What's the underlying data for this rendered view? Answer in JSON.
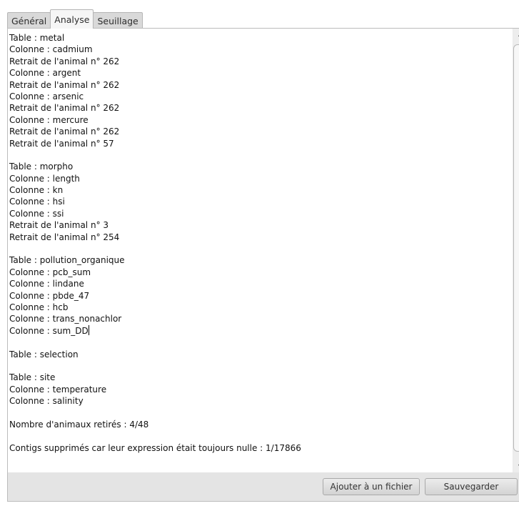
{
  "tabs": [
    {
      "label": "Général",
      "active": false
    },
    {
      "label": "Analyse",
      "active": true
    },
    {
      "label": "Seuillage",
      "active": false
    }
  ],
  "log": {
    "lines": [
      "Table : metal",
      "Colonne : cadmium",
      "Retrait de l'animal n° 262",
      "Colonne : argent",
      "Retrait de l'animal n° 262",
      "Colonne : arsenic",
      "Retrait de l'animal n° 262",
      "Colonne : mercure",
      "Retrait de l'animal n° 262",
      "Retrait de l'animal n° 57",
      "",
      "Table : morpho",
      "Colonne : length",
      "Colonne : kn",
      "Colonne : hsi",
      "Colonne : ssi",
      "Retrait de l'animal n° 3",
      "Retrait de l'animal n° 254",
      "",
      "Table : pollution_organique",
      "Colonne : pcb_sum",
      "Colonne : lindane",
      "Colonne : pbde_47",
      "Colonne : hcb",
      "Colonne : trans_nonachlor",
      "Colonne : sum_DD",
      "",
      "Table : selection",
      "",
      "Table : site",
      "Colonne : temperature",
      "Colonne : salinity",
      "",
      "Nombre d'animaux retirés : 4/48",
      "",
      "Contigs supprimés car leur expression était toujours nulle : 1/17866"
    ]
  },
  "buttons": {
    "add_to_file": "Ajouter à un fichier",
    "save": "Sauvegarder"
  },
  "colors": {
    "panel_bg": "#e9e9e9",
    "text": "#111111",
    "button_border": "#a9a9a9"
  }
}
